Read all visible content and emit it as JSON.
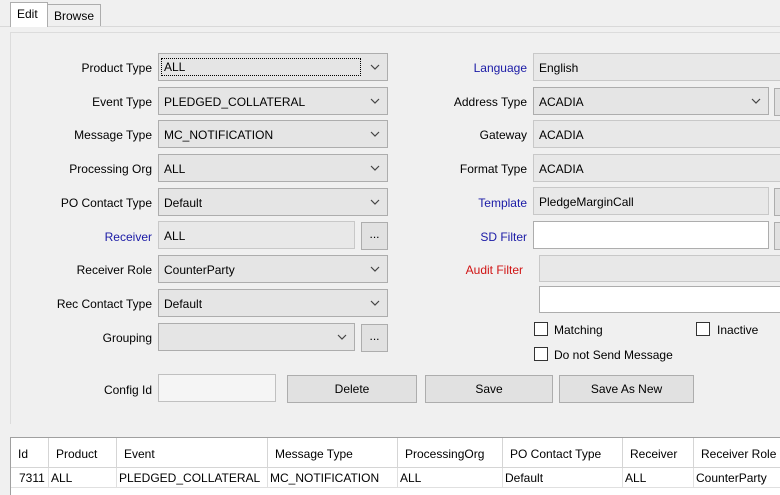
{
  "tabs": [
    {
      "label": "Edit",
      "active": true
    },
    {
      "label": "Browse",
      "active": false
    }
  ],
  "left_form": {
    "product_type": {
      "label": "Product Type",
      "value": "ALL"
    },
    "event_type": {
      "label": "Event Type",
      "value": "PLEDGED_COLLATERAL"
    },
    "message_type": {
      "label": "Message Type",
      "value": "MC_NOTIFICATION"
    },
    "processing_org": {
      "label": "Processing Org",
      "value": "ALL"
    },
    "po_contact_type": {
      "label": "PO Contact Type",
      "value": "Default"
    },
    "receiver": {
      "label": "Receiver",
      "value": "ALL"
    },
    "receiver_role": {
      "label": "Receiver Role",
      "value": "CounterParty"
    },
    "rec_contact_type": {
      "label": "Rec Contact Type",
      "value": "Default"
    },
    "grouping": {
      "label": "Grouping",
      "value": ""
    },
    "config_id": {
      "label": "Config Id",
      "value": ""
    },
    "browse_button_label": "..."
  },
  "right_form": {
    "language": {
      "label": "Language",
      "value": "English"
    },
    "address_type": {
      "label": "Address Type",
      "value": "ACADIA"
    },
    "gateway": {
      "label": "Gateway",
      "value": "ACADIA"
    },
    "format_type": {
      "label": "Format Type",
      "value": "ACADIA"
    },
    "template": {
      "label": "Template",
      "value": "PledgeMarginCall"
    },
    "sd_filter": {
      "label": "SD Filter",
      "value": ""
    },
    "audit_filter": {
      "label": "Audit Filter",
      "value": ""
    },
    "matching": {
      "label": "Matching",
      "checked": false
    },
    "inactive": {
      "label": "Inactive",
      "checked": false
    },
    "do_not_send": {
      "label": "Do not Send Message",
      "checked": false
    }
  },
  "buttons": {
    "delete": "Delete",
    "save": "Save",
    "save_as_new": "Save As New"
  },
  "table": {
    "columns": [
      "Id",
      "Product",
      "Event",
      "Message Type",
      "ProcessingOrg",
      "PO Contact Type",
      "Receiver",
      "Receiver Role"
    ],
    "rows": [
      [
        "7311",
        "ALL",
        "PLEDGED_COLLATERAL",
        "MC_NOTIFICATION",
        "ALL",
        "Default",
        "ALL",
        "CounterParty"
      ]
    ]
  },
  "colors": {
    "link_label": "#1a1aa6",
    "required_label": "#d01414",
    "window_bg": "#f0f0f0"
  }
}
